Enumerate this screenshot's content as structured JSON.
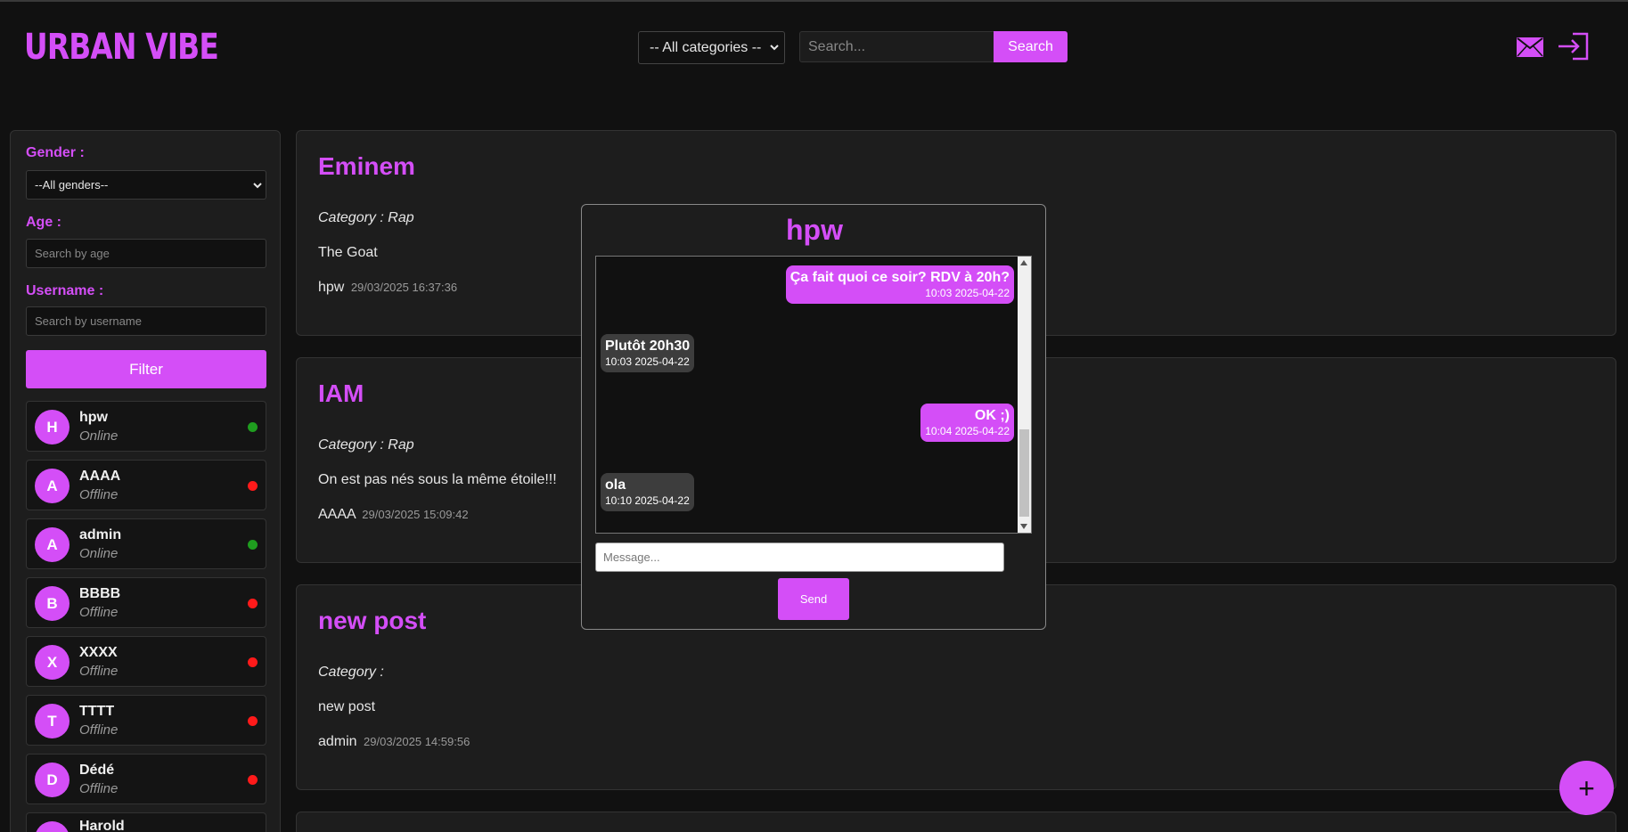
{
  "app": {
    "logo": "URBAN VIBE"
  },
  "header": {
    "category_selected": "-- All categories --",
    "search_placeholder": "Search...",
    "search_button": "Search"
  },
  "sidebar": {
    "gender_label": "Gender :",
    "gender_selected": "--All genders--",
    "age_label": "Age :",
    "age_placeholder": "Search by age",
    "username_label": "Username :",
    "username_placeholder": "Search by username",
    "filter_button": "Filter",
    "users": [
      {
        "initial": "H",
        "name": "hpw",
        "status": "Online",
        "status_color": "#1f9d1f"
      },
      {
        "initial": "A",
        "name": "AAAA",
        "status": "Offline",
        "status_color": "#ff1a1a"
      },
      {
        "initial": "A",
        "name": "admin",
        "status": "Online",
        "status_color": "#1f9d1f"
      },
      {
        "initial": "B",
        "name": "BBBB",
        "status": "Offline",
        "status_color": "#ff1a1a"
      },
      {
        "initial": "X",
        "name": "XXXX",
        "status": "Offline",
        "status_color": "#ff1a1a"
      },
      {
        "initial": "T",
        "name": "TTTT",
        "status": "Offline",
        "status_color": "#ff1a1a"
      },
      {
        "initial": "D",
        "name": "Dédé",
        "status": "Offline",
        "status_color": "#ff1a1a"
      },
      {
        "initial": "H",
        "name": "Harold",
        "status": "",
        "status_color": ""
      }
    ]
  },
  "posts": [
    {
      "title": "Eminem",
      "category": "Category : Rap",
      "body": "The Goat",
      "author": "hpw",
      "date": "29/03/2025 16:37:36"
    },
    {
      "title": "IAM",
      "category": "Category : Rap",
      "body": "On est pas nés sous la même étoile!!!",
      "author": "AAAA",
      "date": "29/03/2025 15:09:42"
    },
    {
      "title": "new post",
      "category": "Category :",
      "body": "new post",
      "author": "admin",
      "date": "29/03/2025 14:59:56"
    }
  ],
  "chat": {
    "title": "hpw",
    "messages": [
      {
        "from": "me",
        "text": "Ça fait quoi ce soir? RDV à 20h?",
        "time": "10:03 2025-04-22"
      },
      {
        "from": "them",
        "text": "Plutôt 20h30",
        "time": "10:03 2025-04-22"
      },
      {
        "from": "me",
        "text": "OK ;)",
        "time": "10:04 2025-04-22"
      },
      {
        "from": "them",
        "text": "ola",
        "time": "10:10 2025-04-22"
      }
    ],
    "input_placeholder": "Message...",
    "send_button": "Send"
  },
  "fab": {
    "label": "+"
  },
  "colors": {
    "accent": "#d44ef7",
    "background": "#111111",
    "panel": "#1d1d1d",
    "online": "#1f9d1f",
    "offline": "#ff1a1a"
  },
  "icons": {
    "messages": "envelope-icon",
    "login": "login-icon",
    "add": "plus-icon"
  }
}
